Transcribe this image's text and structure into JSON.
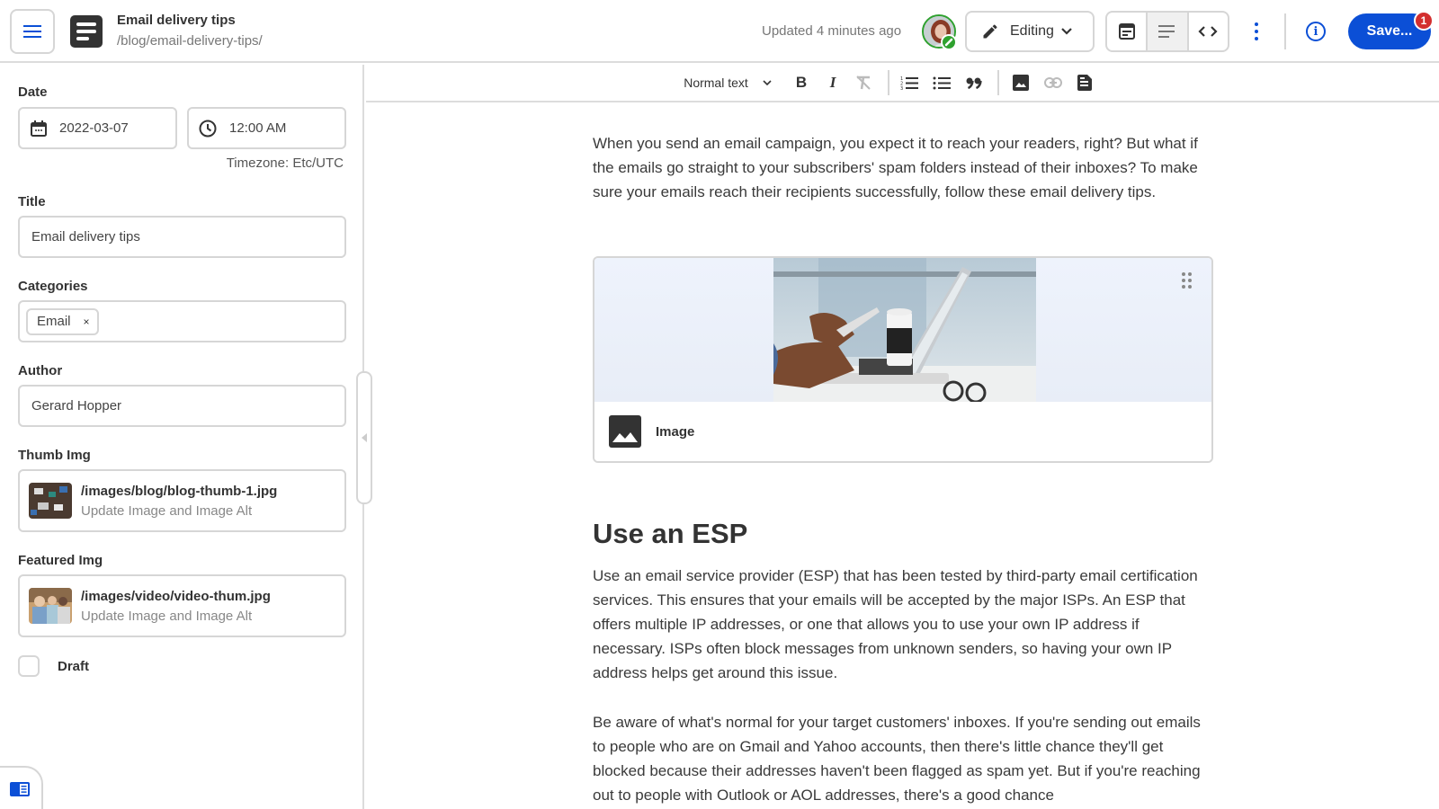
{
  "header": {
    "title": "Email delivery tips",
    "path": "/blog/email-delivery-tips/",
    "updated": "Updated 4 minutes ago",
    "mode_label": "Editing",
    "save_label": "Save...",
    "save_badge": "1",
    "info_glyph": "i"
  },
  "toolbar": {
    "text_style": "Normal text",
    "bold": "B",
    "italic": "I",
    "quote": "”"
  },
  "sidebar": {
    "date_label": "Date",
    "date_value": "2022-03-07",
    "time_value": "12:00 AM",
    "timezone": "Timezone: Etc/UTC",
    "title_label": "Title",
    "title_value": "Email delivery tips",
    "categories_label": "Categories",
    "categories": [
      {
        "label": "Email",
        "remove": "×"
      }
    ],
    "author_label": "Author",
    "author_value": "Gerard Hopper",
    "thumb_label": "Thumb Img",
    "thumb_path": "/images/blog/blog-thumb-1.jpg",
    "thumb_sub": "Update Image and Image Alt",
    "featured_label": "Featured Img",
    "featured_path": "/images/video/video-thum.jpg",
    "featured_sub": "Update Image and Image Alt",
    "draft_label": "Draft",
    "draft_checked": false
  },
  "content": {
    "intro": "When you send an email campaign, you expect it to reach your readers, right? But what if the emails go straight to your subscribers' spam folders instead of their inboxes? To make sure your emails reach their recipients successfully, follow these email delivery tips.",
    "image_block_label": "Image",
    "heading": "Use an ESP",
    "esp_para": "Use an email service provider (ESP) that has been tested by third-party email certification services. This ensures that your emails will be accepted by the major ISPs. An ESP that offers multiple IP addresses, or one that allows you to use your own IP address if necessary. ISPs often block messages from unknown senders, so having your own IP address helps get around this issue.",
    "aware_para": "Be aware of what's normal for your target customers' inboxes. If you're sending out emails to people who are on Gmail and Yahoo accounts, then there's little chance they'll get blocked because their addresses haven't been flagged as spam yet. But if you're reaching out to people with Outlook or AOL addresses, there's a good chance"
  },
  "colors": {
    "accent": "#0b4fd6",
    "presence": "#2ea12e",
    "badge": "#d32f2f"
  }
}
